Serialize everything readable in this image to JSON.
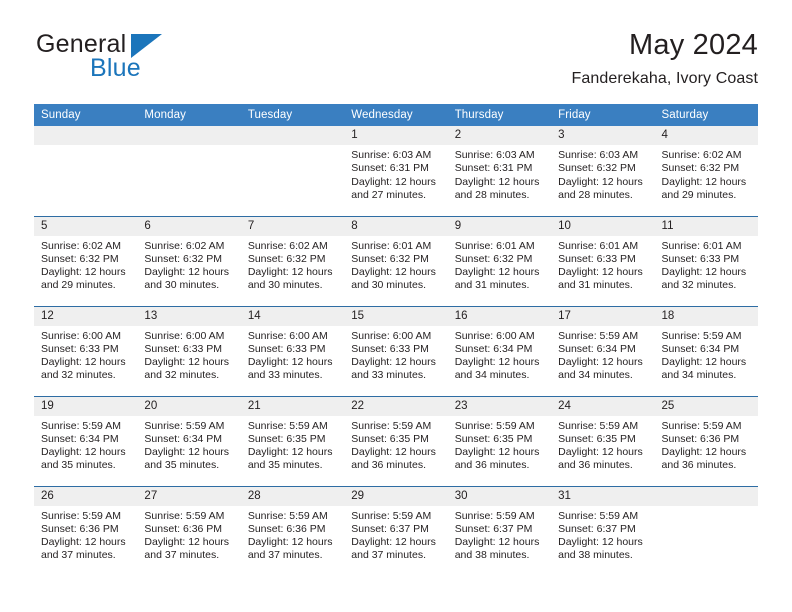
{
  "brand": {
    "name_part1": "General",
    "name_part2": "Blue",
    "logo_icon": "triangle-logo-icon"
  },
  "header": {
    "month_title": "May 2024",
    "location": "Fanderekaha, Ivory Coast"
  },
  "colors": {
    "header_blue": "#3a7fc1",
    "row_divider_blue": "#2e6da4",
    "daynum_strip": "#efefef",
    "brand_blue": "#1b75bb",
    "text": "#231f20"
  },
  "weekday_headers": [
    "Sunday",
    "Monday",
    "Tuesday",
    "Wednesday",
    "Thursday",
    "Friday",
    "Saturday"
  ],
  "labels": {
    "sunrise_prefix": "Sunrise:",
    "sunset_prefix": "Sunset:",
    "daylight_prefix": "Daylight:"
  },
  "weeks": [
    [
      {
        "blank": true
      },
      {
        "blank": true
      },
      {
        "blank": true
      },
      {
        "day": "1",
        "sunrise": "Sunrise: 6:03 AM",
        "sunset": "Sunset: 6:31 PM",
        "daylight_line1": "Daylight: 12 hours",
        "daylight_line2": "and 27 minutes."
      },
      {
        "day": "2",
        "sunrise": "Sunrise: 6:03 AM",
        "sunset": "Sunset: 6:31 PM",
        "daylight_line1": "Daylight: 12 hours",
        "daylight_line2": "and 28 minutes."
      },
      {
        "day": "3",
        "sunrise": "Sunrise: 6:03 AM",
        "sunset": "Sunset: 6:32 PM",
        "daylight_line1": "Daylight: 12 hours",
        "daylight_line2": "and 28 minutes."
      },
      {
        "day": "4",
        "sunrise": "Sunrise: 6:02 AM",
        "sunset": "Sunset: 6:32 PM",
        "daylight_line1": "Daylight: 12 hours",
        "daylight_line2": "and 29 minutes."
      }
    ],
    [
      {
        "day": "5",
        "sunrise": "Sunrise: 6:02 AM",
        "sunset": "Sunset: 6:32 PM",
        "daylight_line1": "Daylight: 12 hours",
        "daylight_line2": "and 29 minutes."
      },
      {
        "day": "6",
        "sunrise": "Sunrise: 6:02 AM",
        "sunset": "Sunset: 6:32 PM",
        "daylight_line1": "Daylight: 12 hours",
        "daylight_line2": "and 30 minutes."
      },
      {
        "day": "7",
        "sunrise": "Sunrise: 6:02 AM",
        "sunset": "Sunset: 6:32 PM",
        "daylight_line1": "Daylight: 12 hours",
        "daylight_line2": "and 30 minutes."
      },
      {
        "day": "8",
        "sunrise": "Sunrise: 6:01 AM",
        "sunset": "Sunset: 6:32 PM",
        "daylight_line1": "Daylight: 12 hours",
        "daylight_line2": "and 30 minutes."
      },
      {
        "day": "9",
        "sunrise": "Sunrise: 6:01 AM",
        "sunset": "Sunset: 6:32 PM",
        "daylight_line1": "Daylight: 12 hours",
        "daylight_line2": "and 31 minutes."
      },
      {
        "day": "10",
        "sunrise": "Sunrise: 6:01 AM",
        "sunset": "Sunset: 6:33 PM",
        "daylight_line1": "Daylight: 12 hours",
        "daylight_line2": "and 31 minutes."
      },
      {
        "day": "11",
        "sunrise": "Sunrise: 6:01 AM",
        "sunset": "Sunset: 6:33 PM",
        "daylight_line1": "Daylight: 12 hours",
        "daylight_line2": "and 32 minutes."
      }
    ],
    [
      {
        "day": "12",
        "sunrise": "Sunrise: 6:00 AM",
        "sunset": "Sunset: 6:33 PM",
        "daylight_line1": "Daylight: 12 hours",
        "daylight_line2": "and 32 minutes."
      },
      {
        "day": "13",
        "sunrise": "Sunrise: 6:00 AM",
        "sunset": "Sunset: 6:33 PM",
        "daylight_line1": "Daylight: 12 hours",
        "daylight_line2": "and 32 minutes."
      },
      {
        "day": "14",
        "sunrise": "Sunrise: 6:00 AM",
        "sunset": "Sunset: 6:33 PM",
        "daylight_line1": "Daylight: 12 hours",
        "daylight_line2": "and 33 minutes."
      },
      {
        "day": "15",
        "sunrise": "Sunrise: 6:00 AM",
        "sunset": "Sunset: 6:33 PM",
        "daylight_line1": "Daylight: 12 hours",
        "daylight_line2": "and 33 minutes."
      },
      {
        "day": "16",
        "sunrise": "Sunrise: 6:00 AM",
        "sunset": "Sunset: 6:34 PM",
        "daylight_line1": "Daylight: 12 hours",
        "daylight_line2": "and 34 minutes."
      },
      {
        "day": "17",
        "sunrise": "Sunrise: 5:59 AM",
        "sunset": "Sunset: 6:34 PM",
        "daylight_line1": "Daylight: 12 hours",
        "daylight_line2": "and 34 minutes."
      },
      {
        "day": "18",
        "sunrise": "Sunrise: 5:59 AM",
        "sunset": "Sunset: 6:34 PM",
        "daylight_line1": "Daylight: 12 hours",
        "daylight_line2": "and 34 minutes."
      }
    ],
    [
      {
        "day": "19",
        "sunrise": "Sunrise: 5:59 AM",
        "sunset": "Sunset: 6:34 PM",
        "daylight_line1": "Daylight: 12 hours",
        "daylight_line2": "and 35 minutes."
      },
      {
        "day": "20",
        "sunrise": "Sunrise: 5:59 AM",
        "sunset": "Sunset: 6:34 PM",
        "daylight_line1": "Daylight: 12 hours",
        "daylight_line2": "and 35 minutes."
      },
      {
        "day": "21",
        "sunrise": "Sunrise: 5:59 AM",
        "sunset": "Sunset: 6:35 PM",
        "daylight_line1": "Daylight: 12 hours",
        "daylight_line2": "and 35 minutes."
      },
      {
        "day": "22",
        "sunrise": "Sunrise: 5:59 AM",
        "sunset": "Sunset: 6:35 PM",
        "daylight_line1": "Daylight: 12 hours",
        "daylight_line2": "and 36 minutes."
      },
      {
        "day": "23",
        "sunrise": "Sunrise: 5:59 AM",
        "sunset": "Sunset: 6:35 PM",
        "daylight_line1": "Daylight: 12 hours",
        "daylight_line2": "and 36 minutes."
      },
      {
        "day": "24",
        "sunrise": "Sunrise: 5:59 AM",
        "sunset": "Sunset: 6:35 PM",
        "daylight_line1": "Daylight: 12 hours",
        "daylight_line2": "and 36 minutes."
      },
      {
        "day": "25",
        "sunrise": "Sunrise: 5:59 AM",
        "sunset": "Sunset: 6:36 PM",
        "daylight_line1": "Daylight: 12 hours",
        "daylight_line2": "and 36 minutes."
      }
    ],
    [
      {
        "day": "26",
        "sunrise": "Sunrise: 5:59 AM",
        "sunset": "Sunset: 6:36 PM",
        "daylight_line1": "Daylight: 12 hours",
        "daylight_line2": "and 37 minutes."
      },
      {
        "day": "27",
        "sunrise": "Sunrise: 5:59 AM",
        "sunset": "Sunset: 6:36 PM",
        "daylight_line1": "Daylight: 12 hours",
        "daylight_line2": "and 37 minutes."
      },
      {
        "day": "28",
        "sunrise": "Sunrise: 5:59 AM",
        "sunset": "Sunset: 6:36 PM",
        "daylight_line1": "Daylight: 12 hours",
        "daylight_line2": "and 37 minutes."
      },
      {
        "day": "29",
        "sunrise": "Sunrise: 5:59 AM",
        "sunset": "Sunset: 6:37 PM",
        "daylight_line1": "Daylight: 12 hours",
        "daylight_line2": "and 37 minutes."
      },
      {
        "day": "30",
        "sunrise": "Sunrise: 5:59 AM",
        "sunset": "Sunset: 6:37 PM",
        "daylight_line1": "Daylight: 12 hours",
        "daylight_line2": "and 38 minutes."
      },
      {
        "day": "31",
        "sunrise": "Sunrise: 5:59 AM",
        "sunset": "Sunset: 6:37 PM",
        "daylight_line1": "Daylight: 12 hours",
        "daylight_line2": "and 38 minutes."
      },
      {
        "blank": true
      }
    ]
  ]
}
